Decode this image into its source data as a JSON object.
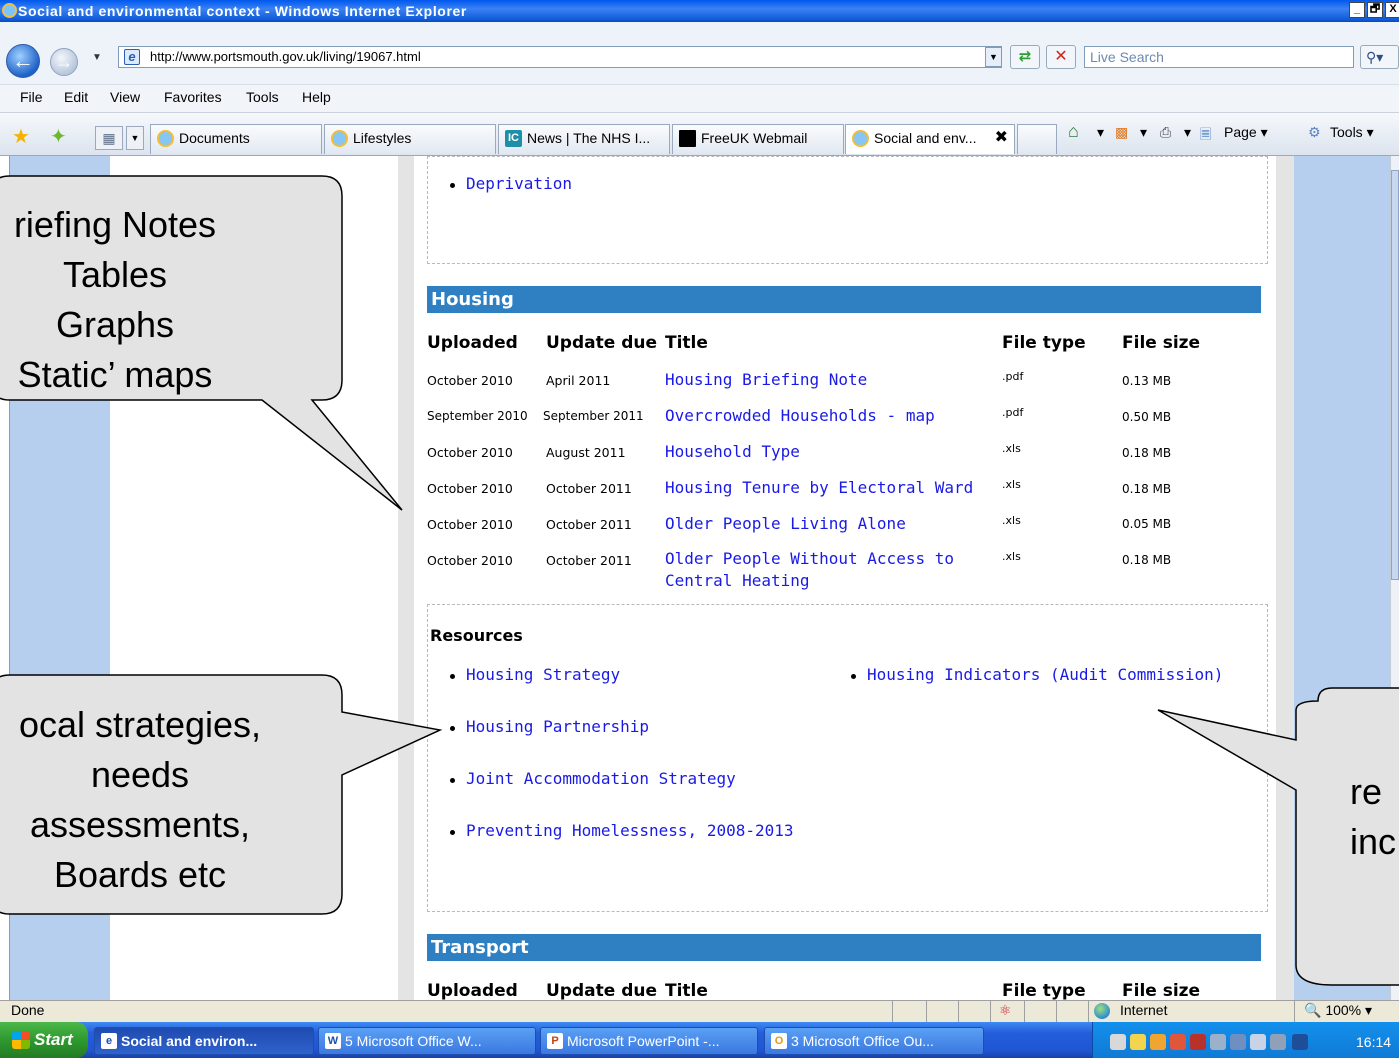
{
  "window": {
    "title": "Social and environmental context - Windows Internet Explorer",
    "controls": [
      "_",
      "🗗",
      "X"
    ]
  },
  "address_bar": {
    "url": "http://www.portsmouth.gov.uk/living/19067.html",
    "search_placeholder": "Live Search"
  },
  "menu": [
    "File",
    "Edit",
    "View",
    "Favorites",
    "Tools",
    "Help"
  ],
  "tabs": [
    {
      "label": "Documents"
    },
    {
      "label": "Lifestyles"
    },
    {
      "label": "News | The NHS I..."
    },
    {
      "label": "FreeUK Webmail"
    },
    {
      "label": "Social and env..."
    }
  ],
  "commands": {
    "page": "Page",
    "tools": "Tools"
  },
  "page": {
    "prev_item": "Deprivation",
    "section": "Housing",
    "next_section": "Transport",
    "columns": {
      "uploaded": "Uploaded",
      "update_due": "Update due",
      "title": "Title",
      "file_type": "File type",
      "file_size": "File size"
    },
    "rows": [
      {
        "uploaded": "October 2010",
        "update_due": "April 2011",
        "title": "Housing Briefing Note",
        "type": ".pdf",
        "size": "0.13 MB"
      },
      {
        "uploaded": "September 2010",
        "update_due": "September 2011",
        "title": "Overcrowded Households - map",
        "type": ".pdf",
        "size": "0.50 MB"
      },
      {
        "uploaded": "October 2010",
        "update_due": "August 2011",
        "title": "Household Type",
        "type": ".xls",
        "size": "0.18 MB"
      },
      {
        "uploaded": "October 2010",
        "update_due": "October 2011",
        "title": "Housing Tenure by Electoral Ward",
        "type": ".xls",
        "size": "0.18 MB"
      },
      {
        "uploaded": "October 2010",
        "update_due": "October 2011",
        "title": "Older People Living Alone",
        "type": ".xls",
        "size": "0.05 MB"
      },
      {
        "uploaded": "October 2010",
        "update_due": "October 2011",
        "title": "Older People Without Access to",
        "title2": "Central Heating",
        "type": ".xls",
        "size": "0.18 MB"
      }
    ],
    "resources_heading": "Resources",
    "resources": [
      "Housing Strategy",
      "Housing Partnership",
      "Joint Accommodation Strategy",
      "Preventing Homelessness, 2008-2013",
      "Housing Indicators (Audit Commission)"
    ],
    "next_columns": {
      "uploaded": "Uploaded",
      "update_due": "Update due",
      "title": "Title",
      "file_type": "File type",
      "file_size": "File size"
    }
  },
  "callouts": {
    "top_left": "riefing Notes\nTables\nGraphs\nStatic’ maps",
    "bottom_left": "ocal strategies,\nneeds\nassessments,\nBoards etc",
    "right": "re\ninc"
  },
  "status": {
    "text": "Done",
    "zone": "Internet",
    "zoom": "100%"
  },
  "taskbar": {
    "start": "Start",
    "buttons": [
      {
        "label": "Social and environ...",
        "icon": "e"
      },
      {
        "label": "5 Microsoft Office W...",
        "icon": "W"
      },
      {
        "label": "Microsoft PowerPoint -...",
        "icon": "P"
      },
      {
        "label": "3 Microsoft Office Ou...",
        "icon": "O"
      }
    ],
    "clock": "16:14"
  }
}
